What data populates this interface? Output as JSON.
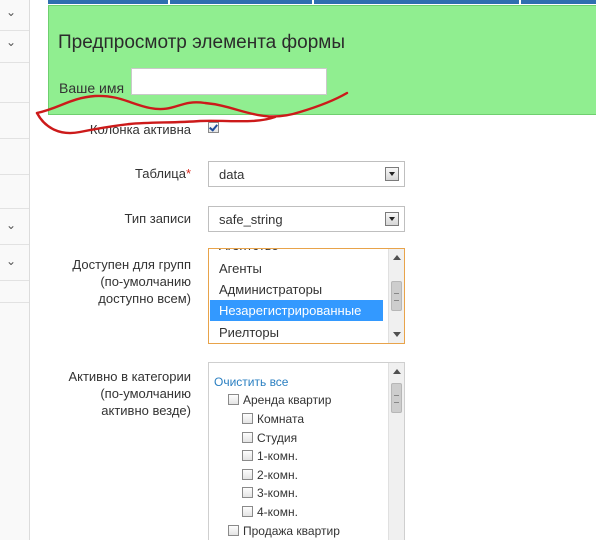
{
  "preview": {
    "title": "Предпросмотр элемента формы",
    "name_label": "Ваше имя",
    "name_value": ""
  },
  "fields": {
    "active_column": {
      "label": "Колонка активна",
      "checked": true
    },
    "table": {
      "label": "Таблица",
      "required_mark": "*",
      "value": "data"
    },
    "record_type": {
      "label": "Тип записи",
      "value": "safe_string"
    },
    "groups": {
      "label_lines": [
        "Доступен для групп",
        "(по-умолчанию",
        "доступно всем)"
      ],
      "items": [
        {
          "label": "Агентство",
          "selected": false
        },
        {
          "label": "Агенты",
          "selected": false
        },
        {
          "label": "Администраторы",
          "selected": false
        },
        {
          "label": "Незарегистрированные",
          "selected": true
        },
        {
          "label": "Риелторы",
          "selected": false
        }
      ]
    },
    "categories": {
      "label_lines": [
        "Активно в категории",
        "(по-умолчанию",
        "активно везде)"
      ],
      "clear_label": "Очистить все",
      "items": [
        {
          "label": "Аренда квартир",
          "level": 0
        },
        {
          "label": "Комната",
          "level": 1
        },
        {
          "label": "Студия",
          "level": 1
        },
        {
          "label": "1-комн.",
          "level": 1
        },
        {
          "label": "2-комн.",
          "level": 1
        },
        {
          "label": "3-комн.",
          "level": 1
        },
        {
          "label": "4-комн.",
          "level": 1
        },
        {
          "label": "Продажа квартир",
          "level": 0
        }
      ]
    }
  },
  "colors": {
    "preview_bg": "#90ee90",
    "annotation": "#cc1a1a",
    "selection": "#3399ff",
    "listbox_focus": "#e8a34a",
    "link": "#2a7fc1"
  }
}
